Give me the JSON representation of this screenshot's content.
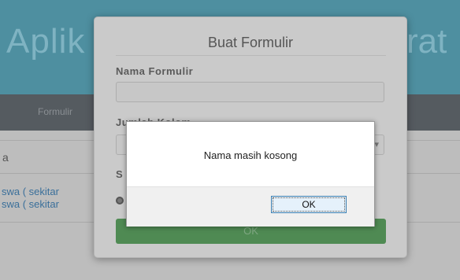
{
  "background": {
    "app_title_left": "Aplik",
    "app_title_right": "rat",
    "nav": {
      "item": "Formulir"
    },
    "content": {
      "heading_fragment": "a",
      "link_1": "swa ( sekitar",
      "link_2": "swa ( sekitar"
    }
  },
  "modal": {
    "title": "Buat Formulir",
    "name_label": "Nama Formulir",
    "column_label": "Jumlah Kolom",
    "section_label": "S",
    "submit_label": "OK"
  },
  "alert": {
    "message": "Nama masih kosong",
    "ok_label": "OK"
  },
  "colors": {
    "header_bg": "#4e8fa0",
    "submit_bg": "#4f8a53",
    "ok_border": "#3c7fb1"
  }
}
